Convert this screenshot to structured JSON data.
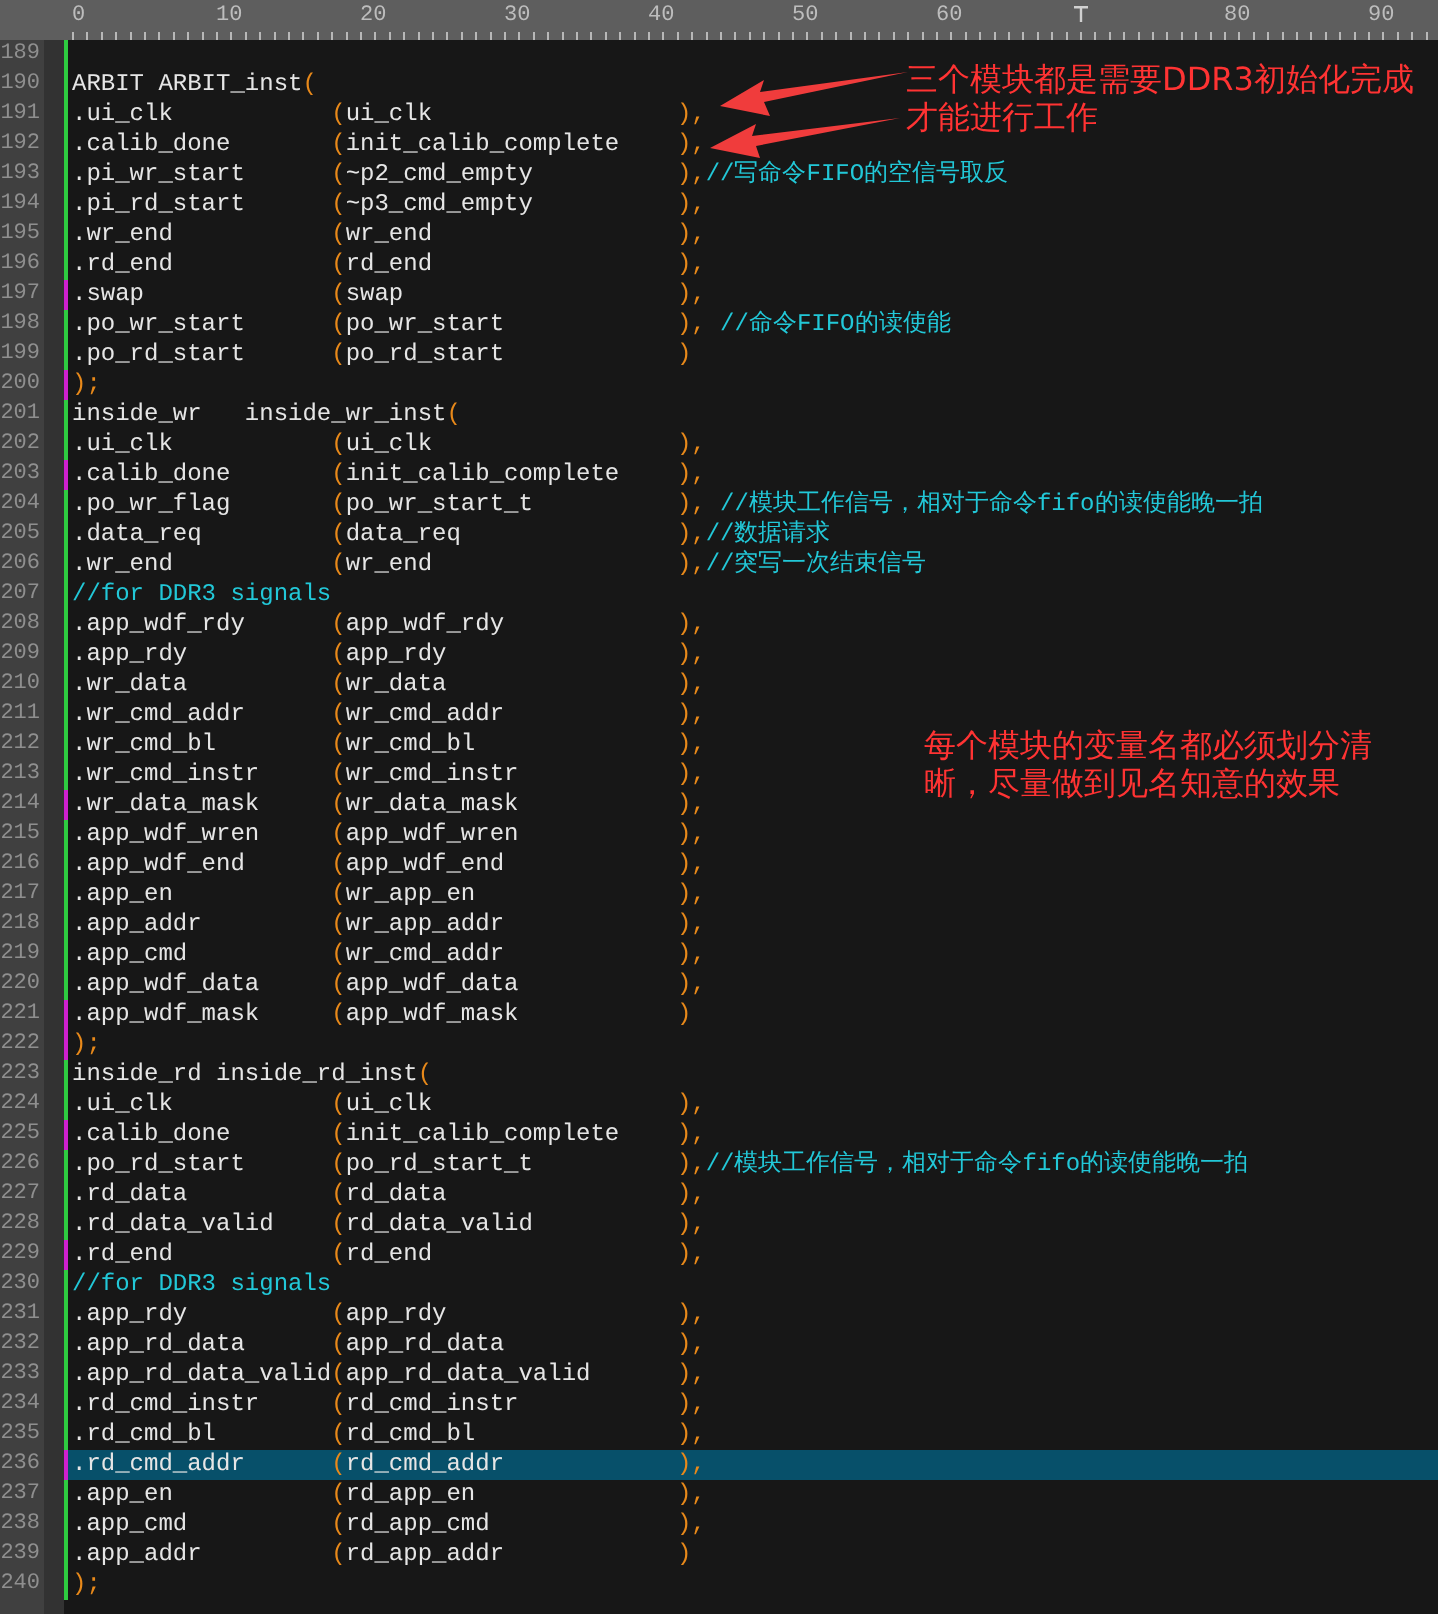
{
  "ruler": {
    "marks": [
      {
        "kind": "label",
        "text": "0"
      },
      {
        "kind": "label",
        "text": "10"
      },
      {
        "kind": "label",
        "text": "20"
      },
      {
        "kind": "label",
        "text": "30"
      },
      {
        "kind": "label",
        "text": "40"
      },
      {
        "kind": "label",
        "text": "50"
      },
      {
        "kind": "label",
        "text": "60"
      },
      {
        "kind": "cursor"
      },
      {
        "kind": "label",
        "text": "80"
      },
      {
        "kind": "label",
        "text": "90"
      }
    ]
  },
  "lines": [
    {
      "number": "189",
      "kind": "blank",
      "color": "#2ecc40",
      "current": false
    },
    {
      "number": "190",
      "kind": "header",
      "header": "ARBIT ARBIT_inst",
      "open": "(",
      "color": "#2ecc40",
      "current": false
    },
    {
      "number": "191",
      "kind": "port",
      "port": ".ui_clk",
      "open": "(",
      "arg": "ui_clk",
      "close": "),",
      "color": "#2ecc40",
      "current": false
    },
    {
      "number": "192",
      "kind": "port",
      "port": ".calib_done",
      "open": "(",
      "arg": "init_calib_complete",
      "close": "),",
      "color": "#2ecc40",
      "current": false
    },
    {
      "number": "193",
      "kind": "port",
      "port": ".pi_wr_start",
      "open": "(",
      "arg": "~p2_cmd_empty",
      "close": "),",
      "comment": "//写命令FIFO的空信号取反",
      "color": "#2ecc40",
      "current": false
    },
    {
      "number": "194",
      "kind": "port",
      "port": ".pi_rd_start",
      "open": "(",
      "arg": "~p3_cmd_empty",
      "close": "),",
      "color": "#2ecc40",
      "current": false
    },
    {
      "number": "195",
      "kind": "port",
      "port": ".wr_end",
      "open": "(",
      "arg": "wr_end",
      "close": "),",
      "color": "#2ecc40",
      "current": false
    },
    {
      "number": "196",
      "kind": "port",
      "port": ".rd_end",
      "open": "(",
      "arg": "rd_end",
      "close": "),",
      "color": "#2ecc40",
      "current": false
    },
    {
      "number": "197",
      "kind": "port",
      "port": ".swap",
      "open": "(",
      "arg": "swap",
      "close": "),",
      "color": "#d020d0",
      "current": false
    },
    {
      "number": "198",
      "kind": "port",
      "port": ".po_wr_start",
      "open": "(",
      "arg": "po_wr_start",
      "close": "),",
      "comment": " //命令FIFO的读使能",
      "color": "#2ecc40",
      "current": false
    },
    {
      "number": "199",
      "kind": "port",
      "port": ".po_rd_start",
      "open": "(",
      "arg": "po_rd_start",
      "close": ")",
      "color": "#2ecc40",
      "current": false
    },
    {
      "number": "200",
      "kind": "end",
      "close": ");",
      "color": "#d020d0",
      "current": false
    },
    {
      "number": "201",
      "kind": "header",
      "header": "inside_wr   inside_wr_inst",
      "open": "(",
      "color": "#2ecc40",
      "current": false
    },
    {
      "number": "202",
      "kind": "port",
      "port": ".ui_clk",
      "open": "(",
      "arg": "ui_clk",
      "close": "),",
      "color": "#2ecc40",
      "current": false
    },
    {
      "number": "203",
      "kind": "port",
      "port": ".calib_done",
      "open": "(",
      "arg": "init_calib_complete",
      "close": "),",
      "color": "#d020d0",
      "current": false
    },
    {
      "number": "204",
      "kind": "port",
      "port": ".po_wr_flag",
      "open": "(",
      "arg": "po_wr_start_t",
      "close": "),",
      "comment": " //模块工作信号，相对于命令fifo的读使能晚一拍",
      "color": "#2ecc40",
      "current": false
    },
    {
      "number": "205",
      "kind": "port",
      "port": ".data_req",
      "open": "(",
      "arg": "data_req",
      "close": "),",
      "comment": "//数据请求",
      "color": "#2ecc40",
      "current": false
    },
    {
      "number": "206",
      "kind": "port",
      "port": ".wr_end",
      "open": "(",
      "arg": "wr_end",
      "close": "),",
      "comment": "//突写一次结束信号",
      "color": "#2ecc40",
      "current": false
    },
    {
      "number": "207",
      "kind": "comment",
      "comment": "//for DDR3 signals",
      "color": "#2ecc40",
      "current": false
    },
    {
      "number": "208",
      "kind": "port",
      "port": ".app_wdf_rdy",
      "open": "(",
      "arg": "app_wdf_rdy",
      "close": "),",
      "color": "#2ecc40",
      "current": false
    },
    {
      "number": "209",
      "kind": "port",
      "port": ".app_rdy",
      "open": "(",
      "arg": "app_rdy",
      "close": "),",
      "color": "#2ecc40",
      "current": false
    },
    {
      "number": "210",
      "kind": "port",
      "port": ".wr_data",
      "open": "(",
      "arg": "wr_data",
      "close": "),",
      "color": "#2ecc40",
      "current": false
    },
    {
      "number": "211",
      "kind": "port",
      "port": ".wr_cmd_addr",
      "open": "(",
      "arg": "wr_cmd_addr",
      "close": "),",
      "color": "#2ecc40",
      "current": false
    },
    {
      "number": "212",
      "kind": "port",
      "port": ".wr_cmd_bl",
      "open": "(",
      "arg": "wr_cmd_bl",
      "close": "),",
      "color": "#2ecc40",
      "current": false
    },
    {
      "number": "213",
      "kind": "port",
      "port": ".wr_cmd_instr",
      "open": "(",
      "arg": "wr_cmd_instr",
      "close": "),",
      "color": "#2ecc40",
      "current": false
    },
    {
      "number": "214",
      "kind": "port",
      "port": ".wr_data_mask",
      "open": "(",
      "arg": "wr_data_mask",
      "close": "),",
      "color": "#d020d0",
      "current": false
    },
    {
      "number": "215",
      "kind": "port",
      "port": ".app_wdf_wren",
      "open": "(",
      "arg": "app_wdf_wren",
      "close": "),",
      "color": "#2ecc40",
      "current": false
    },
    {
      "number": "216",
      "kind": "port",
      "port": ".app_wdf_end",
      "open": "(",
      "arg": "app_wdf_end",
      "close": "),",
      "color": "#2ecc40",
      "current": false
    },
    {
      "number": "217",
      "kind": "port",
      "port": ".app_en",
      "open": "(",
      "arg": "wr_app_en",
      "close": "),",
      "color": "#2ecc40",
      "current": false
    },
    {
      "number": "218",
      "kind": "port",
      "port": ".app_addr",
      "open": "(",
      "arg": "wr_app_addr",
      "close": "),",
      "color": "#2ecc40",
      "current": false
    },
    {
      "number": "219",
      "kind": "port",
      "port": ".app_cmd",
      "open": "(",
      "arg": "wr_cmd_addr",
      "close": "),",
      "color": "#2ecc40",
      "current": false
    },
    {
      "number": "220",
      "kind": "port",
      "port": ".app_wdf_data",
      "open": "(",
      "arg": "app_wdf_data",
      "close": "),",
      "color": "#2ecc40",
      "current": false
    },
    {
      "number": "221",
      "kind": "port",
      "port": ".app_wdf_mask",
      "open": "(",
      "arg": "app_wdf_mask",
      "close": ")",
      "color": "#d020d0",
      "current": false
    },
    {
      "number": "222",
      "kind": "end",
      "close": ");",
      "color": "#d020d0",
      "current": false
    },
    {
      "number": "223",
      "kind": "header",
      "header": "inside_rd inside_rd_inst",
      "open": "(",
      "color": "#2ecc40",
      "current": false
    },
    {
      "number": "224",
      "kind": "port",
      "port": ".ui_clk",
      "open": "(",
      "arg": "ui_clk",
      "close": "),",
      "color": "#2ecc40",
      "current": false
    },
    {
      "number": "225",
      "kind": "port",
      "port": ".calib_done",
      "open": "(",
      "arg": "init_calib_complete",
      "close": "),",
      "color": "#d020d0",
      "current": false
    },
    {
      "number": "226",
      "kind": "port",
      "port": ".po_rd_start",
      "open": "(",
      "arg": "po_rd_start_t",
      "close": "),",
      "comment": "//模块工作信号，相对于命令fifo的读使能晚一拍",
      "color": "#2ecc40",
      "current": false
    },
    {
      "number": "227",
      "kind": "port",
      "port": ".rd_data",
      "open": "(",
      "arg": "rd_data",
      "close": "),",
      "color": "#2ecc40",
      "current": false
    },
    {
      "number": "228",
      "kind": "port",
      "port": ".rd_data_valid",
      "open": "(",
      "arg": "rd_data_valid",
      "close": "),",
      "color": "#2ecc40",
      "current": false
    },
    {
      "number": "229",
      "kind": "port",
      "port": ".rd_end",
      "open": "(",
      "arg": "rd_end",
      "close": "),",
      "color": "#d020d0",
      "current": false
    },
    {
      "number": "230",
      "kind": "comment",
      "comment": "//for DDR3 signals",
      "color": "#2ecc40",
      "current": false
    },
    {
      "number": "231",
      "kind": "port",
      "port": ".app_rdy",
      "open": "(",
      "arg": "app_rdy",
      "close": "),",
      "color": "#2ecc40",
      "current": false
    },
    {
      "number": "232",
      "kind": "port",
      "port": ".app_rd_data",
      "open": "(",
      "arg": "app_rd_data",
      "close": "),",
      "color": "#2ecc40",
      "current": false
    },
    {
      "number": "233",
      "kind": "port",
      "port": ".app_rd_data_valid",
      "open": "(",
      "arg": "app_rd_data_valid",
      "close": "),",
      "color": "#2ecc40",
      "current": false
    },
    {
      "number": "234",
      "kind": "port",
      "port": ".rd_cmd_instr",
      "open": "(",
      "arg": "rd_cmd_instr",
      "close": "),",
      "color": "#2ecc40",
      "current": false
    },
    {
      "number": "235",
      "kind": "port",
      "port": ".rd_cmd_bl",
      "open": "(",
      "arg": "rd_cmd_bl",
      "close": "),",
      "color": "#2ecc40",
      "current": false
    },
    {
      "number": "236",
      "kind": "port",
      "port": ".rd_cmd_addr",
      "open": "(",
      "arg": "rd_cmd_addr",
      "close": "),",
      "color": "#d020d0",
      "current": true
    },
    {
      "number": "237",
      "kind": "port",
      "port": ".app_en",
      "open": "(",
      "arg": "rd_app_en",
      "close": "),",
      "color": "#2ecc40",
      "current": false
    },
    {
      "number": "238",
      "kind": "port",
      "port": ".app_cmd",
      "open": "(",
      "arg": "rd_app_cmd",
      "close": "),",
      "color": "#2ecc40",
      "current": false
    },
    {
      "number": "239",
      "kind": "port",
      "port": ".app_addr",
      "open": "(",
      "arg": "rd_app_addr",
      "close": ")",
      "color": "#2ecc40",
      "current": false
    },
    {
      "number": "240",
      "kind": "end",
      "close": ");",
      "color": "#2ecc40",
      "current": false
    }
  ],
  "annotations": [
    {
      "lines": [
        "三个模块都是需要DDR3初始化完成",
        "才能进行工作"
      ]
    },
    {
      "lines": [
        "每个模块的变量名都必须划分清",
        "晰，尽量做到见名知意的效果"
      ]
    }
  ]
}
